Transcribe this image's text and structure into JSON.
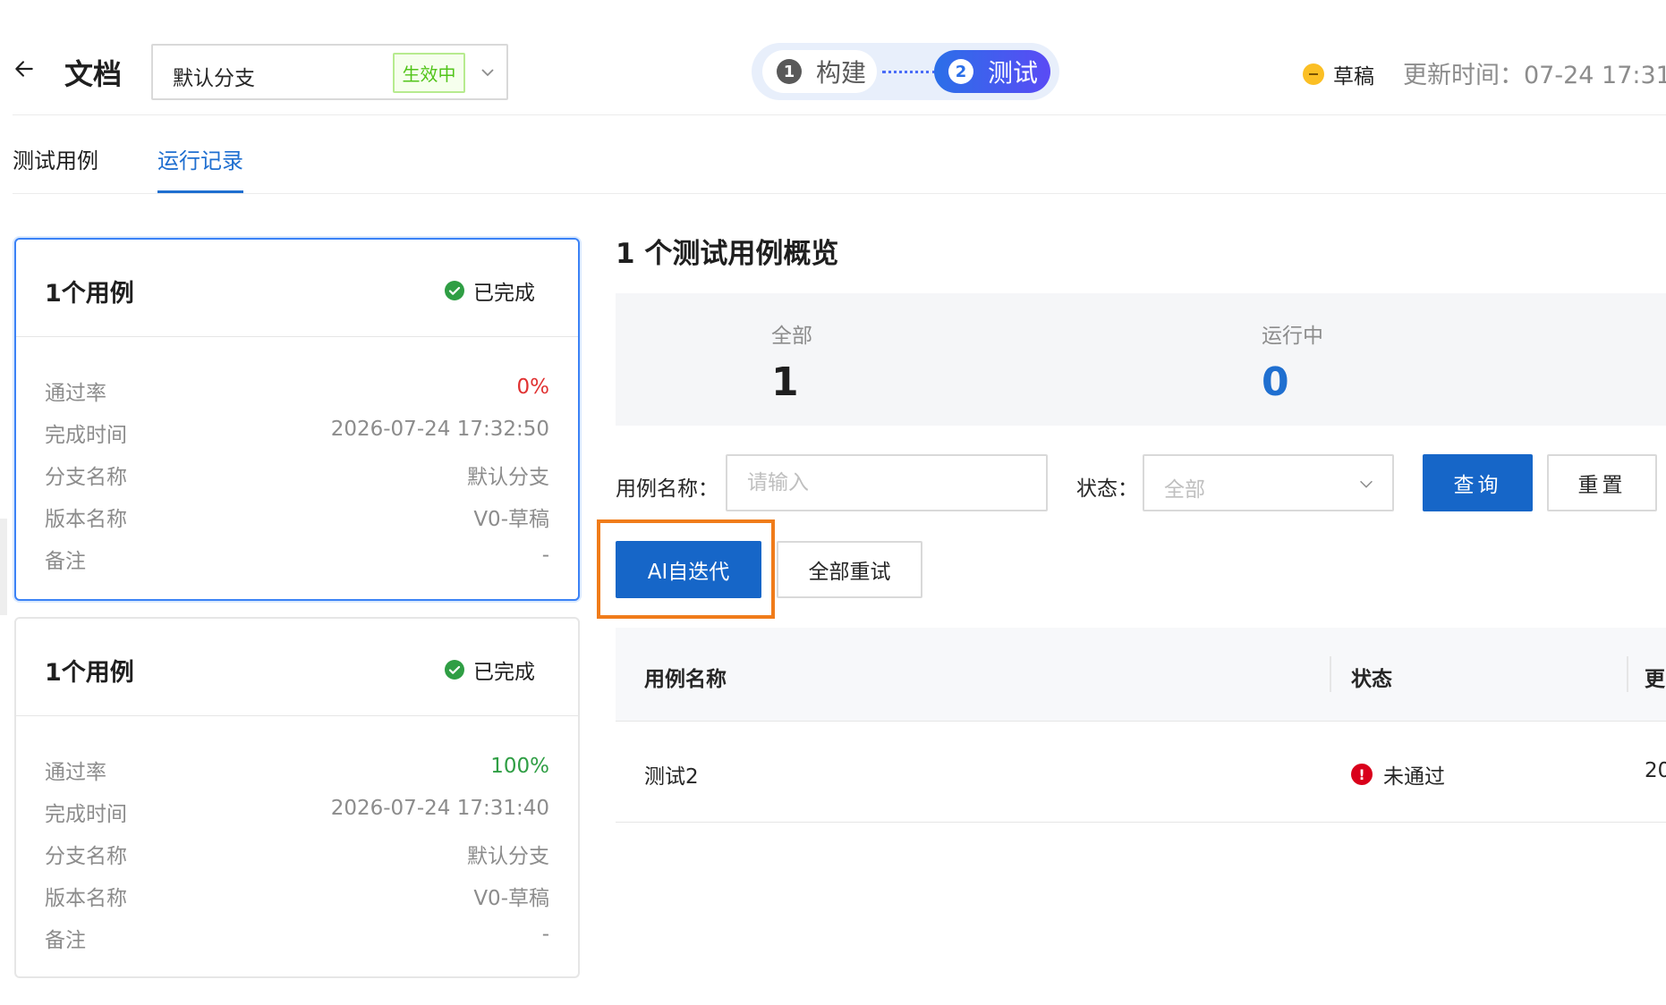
{
  "header": {
    "title": "文档",
    "branch": {
      "value": "默认分支",
      "tag": "生效中"
    },
    "steps": [
      {
        "num": "1",
        "label": "构建"
      },
      {
        "num": "2",
        "label": "测试"
      }
    ],
    "status_label": "草稿",
    "update_time": "更新时间：07-24 17:31"
  },
  "tabs": [
    {
      "label": "测试用例",
      "active": false
    },
    {
      "label": "运行记录",
      "active": true
    }
  ],
  "runs": [
    {
      "title": "1个用例",
      "status": "已完成",
      "rows": [
        {
          "label": "通过率",
          "value": "0%"
        },
        {
          "label": "完成时间",
          "value": "2026-07-24 17:32:50"
        },
        {
          "label": "分支名称",
          "value": "默认分支"
        },
        {
          "label": "版本名称",
          "value": "V0-草稿"
        },
        {
          "label": "备注",
          "value": "-"
        }
      ]
    },
    {
      "title": "1个用例",
      "status": "已完成",
      "rows": [
        {
          "label": "通过率",
          "value": "100%"
        },
        {
          "label": "完成时间",
          "value": "2026-07-24 17:31:40"
        },
        {
          "label": "分支名称",
          "value": "默认分支"
        },
        {
          "label": "版本名称",
          "value": "V0-草稿"
        },
        {
          "label": "备注",
          "value": "-"
        }
      ]
    }
  ],
  "overview": {
    "title": "1 个测试用例概览",
    "stats": [
      {
        "label": "全部",
        "value": "1"
      },
      {
        "label": "运行中",
        "value": "0"
      }
    ]
  },
  "filters": {
    "name_label": "用例名称：",
    "name_placeholder": "请输入",
    "status_label": "状态：",
    "status_value": "全部",
    "query_label": "查询",
    "reset_label": "重置"
  },
  "actions": {
    "ai_iterate": "AI自迭代",
    "retry_all": "全部重试"
  },
  "table": {
    "columns": [
      "用例名称",
      "状态",
      "更"
    ],
    "rows": [
      {
        "name": "测试2",
        "status": "未通过",
        "more": "20"
      }
    ]
  },
  "colors": {
    "primary": "#1666c8",
    "active_tab": "#1f6fd0",
    "success": "#2f9e44",
    "danger": "#e03131",
    "error_icon": "#d9001b",
    "highlight": "#f07c1a",
    "draft_dot": "#fbbf24"
  },
  "icons": {
    "back": "arrow-left-icon",
    "chevron": "chevron-down-icon",
    "completed": "check-circle-icon",
    "failed": "exclamation-circle-icon",
    "draft": "minus-circle-icon"
  }
}
